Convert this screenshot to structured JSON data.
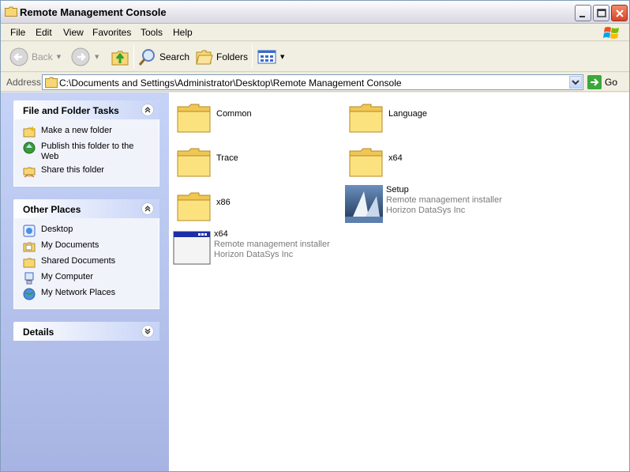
{
  "window": {
    "title": "Remote Management Console"
  },
  "menu": [
    "File",
    "Edit",
    "View",
    "Favorites",
    "Tools",
    "Help"
  ],
  "toolbar": {
    "back": "Back",
    "search": "Search",
    "folders": "Folders"
  },
  "address": {
    "label": "Address",
    "path": "C:\\Documents and Settings\\Administrator\\Desktop\\Remote Management Console",
    "go": "Go"
  },
  "tasks": {
    "title": "File and Folder Tasks",
    "items": [
      "Make a new folder",
      "Publish this folder to the Web",
      "Share this folder"
    ]
  },
  "other_places": {
    "title": "Other Places",
    "items": [
      "Desktop",
      "My Documents",
      "Shared Documents",
      "My Computer",
      "My Network Places"
    ]
  },
  "details": {
    "title": "Details"
  },
  "files": [
    {
      "name": "Common"
    },
    {
      "name": "Language"
    },
    {
      "name": "Trace"
    },
    {
      "name": "x64"
    },
    {
      "name": "x86"
    },
    {
      "name": "Setup",
      "desc": "Remote management installer",
      "company": "Horizon DataSys Inc"
    },
    {
      "name": "x64",
      "desc": "Remote management installer",
      "company": "Horizon DataSys Inc"
    }
  ]
}
